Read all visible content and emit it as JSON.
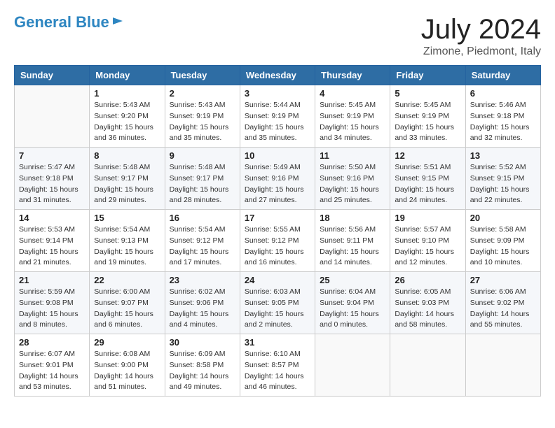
{
  "header": {
    "logo_line1": "General",
    "logo_line2": "Blue",
    "title": "July 2024",
    "subtitle": "Zimone, Piedmont, Italy"
  },
  "weekdays": [
    "Sunday",
    "Monday",
    "Tuesday",
    "Wednesday",
    "Thursday",
    "Friday",
    "Saturday"
  ],
  "weeks": [
    [
      {
        "day": "",
        "sunrise": "",
        "sunset": "",
        "daylight": ""
      },
      {
        "day": "1",
        "sunrise": "Sunrise: 5:43 AM",
        "sunset": "Sunset: 9:20 PM",
        "daylight": "Daylight: 15 hours and 36 minutes."
      },
      {
        "day": "2",
        "sunrise": "Sunrise: 5:43 AM",
        "sunset": "Sunset: 9:19 PM",
        "daylight": "Daylight: 15 hours and 35 minutes."
      },
      {
        "day": "3",
        "sunrise": "Sunrise: 5:44 AM",
        "sunset": "Sunset: 9:19 PM",
        "daylight": "Daylight: 15 hours and 35 minutes."
      },
      {
        "day": "4",
        "sunrise": "Sunrise: 5:45 AM",
        "sunset": "Sunset: 9:19 PM",
        "daylight": "Daylight: 15 hours and 34 minutes."
      },
      {
        "day": "5",
        "sunrise": "Sunrise: 5:45 AM",
        "sunset": "Sunset: 9:19 PM",
        "daylight": "Daylight: 15 hours and 33 minutes."
      },
      {
        "day": "6",
        "sunrise": "Sunrise: 5:46 AM",
        "sunset": "Sunset: 9:18 PM",
        "daylight": "Daylight: 15 hours and 32 minutes."
      }
    ],
    [
      {
        "day": "7",
        "sunrise": "Sunrise: 5:47 AM",
        "sunset": "Sunset: 9:18 PM",
        "daylight": "Daylight: 15 hours and 31 minutes."
      },
      {
        "day": "8",
        "sunrise": "Sunrise: 5:48 AM",
        "sunset": "Sunset: 9:17 PM",
        "daylight": "Daylight: 15 hours and 29 minutes."
      },
      {
        "day": "9",
        "sunrise": "Sunrise: 5:48 AM",
        "sunset": "Sunset: 9:17 PM",
        "daylight": "Daylight: 15 hours and 28 minutes."
      },
      {
        "day": "10",
        "sunrise": "Sunrise: 5:49 AM",
        "sunset": "Sunset: 9:16 PM",
        "daylight": "Daylight: 15 hours and 27 minutes."
      },
      {
        "day": "11",
        "sunrise": "Sunrise: 5:50 AM",
        "sunset": "Sunset: 9:16 PM",
        "daylight": "Daylight: 15 hours and 25 minutes."
      },
      {
        "day": "12",
        "sunrise": "Sunrise: 5:51 AM",
        "sunset": "Sunset: 9:15 PM",
        "daylight": "Daylight: 15 hours and 24 minutes."
      },
      {
        "day": "13",
        "sunrise": "Sunrise: 5:52 AM",
        "sunset": "Sunset: 9:15 PM",
        "daylight": "Daylight: 15 hours and 22 minutes."
      }
    ],
    [
      {
        "day": "14",
        "sunrise": "Sunrise: 5:53 AM",
        "sunset": "Sunset: 9:14 PM",
        "daylight": "Daylight: 15 hours and 21 minutes."
      },
      {
        "day": "15",
        "sunrise": "Sunrise: 5:54 AM",
        "sunset": "Sunset: 9:13 PM",
        "daylight": "Daylight: 15 hours and 19 minutes."
      },
      {
        "day": "16",
        "sunrise": "Sunrise: 5:54 AM",
        "sunset": "Sunset: 9:12 PM",
        "daylight": "Daylight: 15 hours and 17 minutes."
      },
      {
        "day": "17",
        "sunrise": "Sunrise: 5:55 AM",
        "sunset": "Sunset: 9:12 PM",
        "daylight": "Daylight: 15 hours and 16 minutes."
      },
      {
        "day": "18",
        "sunrise": "Sunrise: 5:56 AM",
        "sunset": "Sunset: 9:11 PM",
        "daylight": "Daylight: 15 hours and 14 minutes."
      },
      {
        "day": "19",
        "sunrise": "Sunrise: 5:57 AM",
        "sunset": "Sunset: 9:10 PM",
        "daylight": "Daylight: 15 hours and 12 minutes."
      },
      {
        "day": "20",
        "sunrise": "Sunrise: 5:58 AM",
        "sunset": "Sunset: 9:09 PM",
        "daylight": "Daylight: 15 hours and 10 minutes."
      }
    ],
    [
      {
        "day": "21",
        "sunrise": "Sunrise: 5:59 AM",
        "sunset": "Sunset: 9:08 PM",
        "daylight": "Daylight: 15 hours and 8 minutes."
      },
      {
        "day": "22",
        "sunrise": "Sunrise: 6:00 AM",
        "sunset": "Sunset: 9:07 PM",
        "daylight": "Daylight: 15 hours and 6 minutes."
      },
      {
        "day": "23",
        "sunrise": "Sunrise: 6:02 AM",
        "sunset": "Sunset: 9:06 PM",
        "daylight": "Daylight: 15 hours and 4 minutes."
      },
      {
        "day": "24",
        "sunrise": "Sunrise: 6:03 AM",
        "sunset": "Sunset: 9:05 PM",
        "daylight": "Daylight: 15 hours and 2 minutes."
      },
      {
        "day": "25",
        "sunrise": "Sunrise: 6:04 AM",
        "sunset": "Sunset: 9:04 PM",
        "daylight": "Daylight: 15 hours and 0 minutes."
      },
      {
        "day": "26",
        "sunrise": "Sunrise: 6:05 AM",
        "sunset": "Sunset: 9:03 PM",
        "daylight": "Daylight: 14 hours and 58 minutes."
      },
      {
        "day": "27",
        "sunrise": "Sunrise: 6:06 AM",
        "sunset": "Sunset: 9:02 PM",
        "daylight": "Daylight: 14 hours and 55 minutes."
      }
    ],
    [
      {
        "day": "28",
        "sunrise": "Sunrise: 6:07 AM",
        "sunset": "Sunset: 9:01 PM",
        "daylight": "Daylight: 14 hours and 53 minutes."
      },
      {
        "day": "29",
        "sunrise": "Sunrise: 6:08 AM",
        "sunset": "Sunset: 9:00 PM",
        "daylight": "Daylight: 14 hours and 51 minutes."
      },
      {
        "day": "30",
        "sunrise": "Sunrise: 6:09 AM",
        "sunset": "Sunset: 8:58 PM",
        "daylight": "Daylight: 14 hours and 49 minutes."
      },
      {
        "day": "31",
        "sunrise": "Sunrise: 6:10 AM",
        "sunset": "Sunset: 8:57 PM",
        "daylight": "Daylight: 14 hours and 46 minutes."
      },
      {
        "day": "",
        "sunrise": "",
        "sunset": "",
        "daylight": ""
      },
      {
        "day": "",
        "sunrise": "",
        "sunset": "",
        "daylight": ""
      },
      {
        "day": "",
        "sunrise": "",
        "sunset": "",
        "daylight": ""
      }
    ]
  ]
}
